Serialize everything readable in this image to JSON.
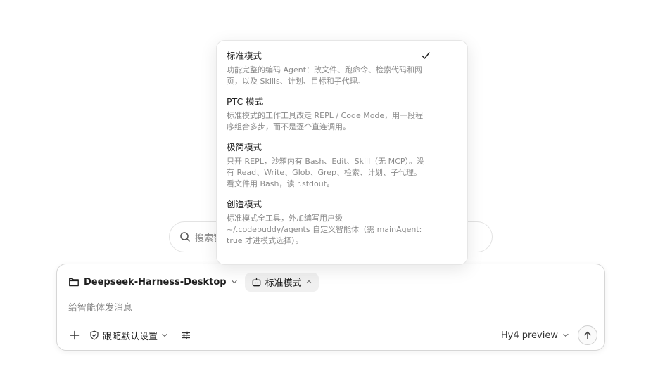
{
  "search": {
    "placeholder_visible": "搜索智"
  },
  "mode_menu": {
    "options": [
      {
        "name": "标准模式",
        "desc": "功能完整的编码 Agent：改文件、跑命令、检索代码和网页，以及 Skills、计划、目标和子代理。",
        "selected": true
      },
      {
        "name": "PTC 模式",
        "desc": "标准模式的工作工具改走 REPL / Code Mode，用一段程序组合多步，而不是逐个直连调用。",
        "selected": false
      },
      {
        "name": "极简模式",
        "desc": "只开 REPL，沙箱内有 Bash、Edit、Skill（无 MCP）。没有 Read、Write、Glob、Grep、检索、计划、子代理。看文件用 Bash，读 r.stdout。",
        "selected": false
      },
      {
        "name": "创造模式",
        "desc": "标准模式全工具，外加编写用户级 ~/.codebuddy/agents 自定义智能体（需 mainAgent: true 才进模式选择）。",
        "selected": false
      }
    ]
  },
  "composer": {
    "project_name": "Deepseek-Harness-Desktop",
    "mode_label": "标准模式",
    "input_placeholder": "给智能体发消息",
    "input_value": "",
    "permission_label": "跟随默认设置",
    "model_label": "Hy4 preview"
  },
  "icons": {
    "search": "search-icon",
    "folder": "folder-icon",
    "bot": "bot-icon",
    "check": "check-icon",
    "plus": "plus-icon",
    "shield": "shield-check-icon",
    "tune": "sliders-icon",
    "send": "arrow-up-icon"
  },
  "colors": {
    "text": "#1f1f1f",
    "muted": "#8a8a8a",
    "chip_bg": "#f0f0f0",
    "border": "#d6d6d6"
  }
}
